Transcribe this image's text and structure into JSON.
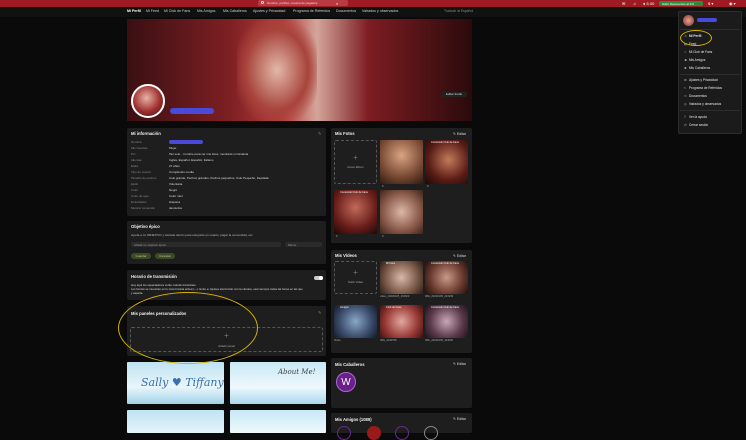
{
  "topbar": {
    "search_placeholder": "Nombre, perfiles, nuestra de pagados",
    "right_items": [
      "2",
      "● 5.00"
    ],
    "upgrade_label": "Subir Descuentos al 3%"
  },
  "nav": {
    "items": [
      "Mi Perfil",
      "Mi Feed",
      "Mi Club de Fans",
      "Mis Amigos",
      "Mis Caballeros",
      "Ajustes y Privacidad",
      "Programa de Referidos",
      "Documentos",
      "Valrados y observados"
    ],
    "language": "Traducir al Español"
  },
  "cover": {
    "edit_label": "Editar fondo"
  },
  "info": {
    "title": "Mi información",
    "rows": [
      {
        "k": "Nombre",
        "v": ""
      },
      {
        "k": "Mis Cuentas",
        "v": "Mujer"
      },
      {
        "k": "Por",
        "v": "Tan solo... hombre para ver mis fotos, mostrarte mi fantasía"
      },
      {
        "k": "Idiomas",
        "v": "Inglés, Español, Español, Italiano"
      },
      {
        "k": "Edad",
        "v": "27 años"
      },
      {
        "k": "Tipo de cuerpo",
        "v": "Complexión media"
      },
      {
        "k": "Tamaño de pechos",
        "v": "Culo grande, Pechos grandes, Pechos pequeños, Culo Pequeño, Depilada"
      },
      {
        "k": "Estilo",
        "v": "Voluntaria"
      },
      {
        "k": "Color",
        "v": "Negro"
      },
      {
        "k": "Color de ojos",
        "v": "Color miel"
      },
      {
        "k": "Etnicidades",
        "v": "Hispana"
      },
      {
        "k": "Mostrar contenido",
        "v": "desnudos"
      }
    ]
  },
  "goals": {
    "title": "Objetivo épico",
    "desc": "Ayuda a mi OBJETIVO y siéntate dentro para estuyarte en cuanto, pagar la comunidad, etc.",
    "input_placeholder": "Añadir un objetivo épico",
    "amount_placeholder": "Monto",
    "save_label": "Guardar",
    "cancel_label": "Cancelar"
  },
  "stream": {
    "title": "Horario de transmisión",
    "text1": "Hoy aquí los espectadores verán cuando transmites.",
    "text2": "Los fondos se muestran en tu zona horaria actual (—). Entre a: Ajustes sincronizar con la cámara, usar siempre todas las horas en las que",
    "text3": "y aspeña."
  },
  "custom": {
    "title": "Mis paneles personalizados",
    "add_label": "Añadir panel"
  },
  "banners": {
    "left": "Sally ♥ Tiffany",
    "right": "About Me!"
  },
  "photos": {
    "title": "Mis Fotos",
    "edit_label": "Editar",
    "add_label": "Crear álbum",
    "tags": [
      "Contenido Club de Fans",
      "Contenido Club de Fans"
    ],
    "counts": [
      "9",
      "9",
      "9",
      "9",
      "9"
    ]
  },
  "videos": {
    "title": "Mis Vídeos",
    "edit_label": "Editar",
    "add_label": "Subir vídeo",
    "items": [
      "video_20230105_161523",
      "IMG_20230105_221939",
      "Video",
      "IMG_4130768",
      "IMG_20230105_104050"
    ],
    "tags": [
      "Mi Fans",
      "Contenido Club de Fans",
      "Amigos",
      "Club de Fans",
      "Contenido Club de Fans"
    ]
  },
  "gentlemen": {
    "title": "Mis Caballeros",
    "edit_label": "Editar",
    "initial": "W"
  },
  "friends": {
    "title": "Mis Amigos (1089)",
    "edit_label": "Editar"
  },
  "menu": {
    "items": [
      "Mi Perfil",
      "Feed",
      "Mi Club de Fans",
      "Mis Amigos",
      "Mis Caballeros",
      "Ajustes y Privacidad",
      "Programa de Referidos",
      "Documentos",
      "Valrados y observados",
      "Ver la ayuda",
      "Cerrar sesión"
    ]
  },
  "colors": {
    "brand_red": "#9e1b24",
    "highlight": "#d6b100",
    "upgrade_green": "#2f8b3b"
  }
}
